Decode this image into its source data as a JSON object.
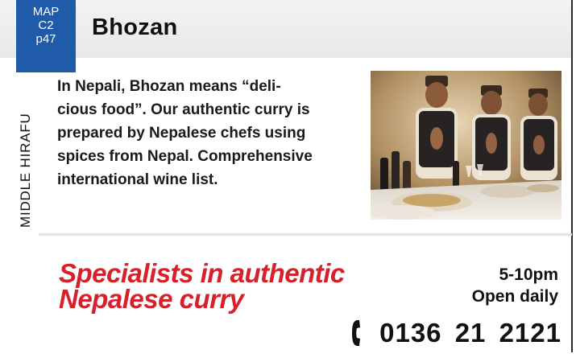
{
  "map_badge": {
    "map_label": "MAP",
    "grid": "C2",
    "page": "p47",
    "color": "#1f5ba8"
  },
  "title": "Bhozan",
  "area": "MIDDLE HIRAFU",
  "description_lines": [
    "In Nepali, Bhozan means “deli-",
    "cious food”. Our authentic curry is",
    "prepared by Nepalese chefs using",
    "spices from Nepal. Comprehensive",
    "international wine list."
  ],
  "photo": {
    "icon": "restaurant-staff-photo"
  },
  "slogan_lines": [
    "Specialists in authentic",
    "Nepalese curry"
  ],
  "slogan_color": "#d6202a",
  "hours": {
    "time": "5-10pm",
    "days": "Open daily"
  },
  "phone": {
    "icon": "phone-icon",
    "number": "0136 21 2121"
  }
}
